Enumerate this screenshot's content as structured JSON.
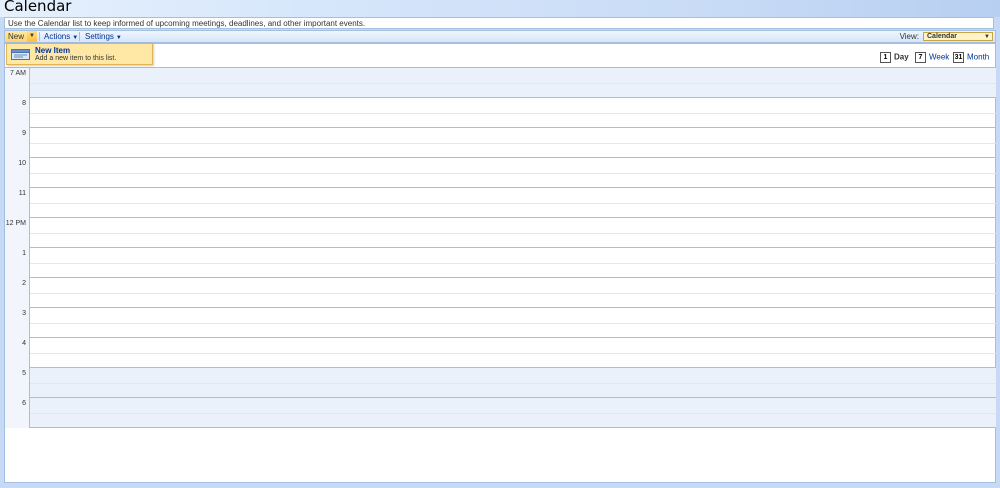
{
  "page": {
    "title": "Calendar",
    "description": "Use the Calendar list to keep informed of upcoming meetings, deadlines, and other important events."
  },
  "toolbar": {
    "new_label": "New",
    "actions_label": "Actions",
    "settings_label": "Settings",
    "view_label": "View:",
    "view_value": "Calendar"
  },
  "new_menu": {
    "item_title": "New Item",
    "item_desc": "Add a new item to this list."
  },
  "view_switch": {
    "day": "Day",
    "week": "Week",
    "month": "Month",
    "day_num": "1",
    "week_num": "7",
    "month_num": "31"
  },
  "hours": [
    "7 AM",
    "8",
    "9",
    "10",
    "11",
    "12 PM",
    "1",
    "2",
    "3",
    "4",
    "5",
    "6"
  ],
  "off_hours": [
    0,
    10,
    11
  ],
  "colors": {
    "accent": "#ffd46a",
    "grid_line": "#a5bfe1",
    "off_hours_bg": "#eaf1fb"
  }
}
